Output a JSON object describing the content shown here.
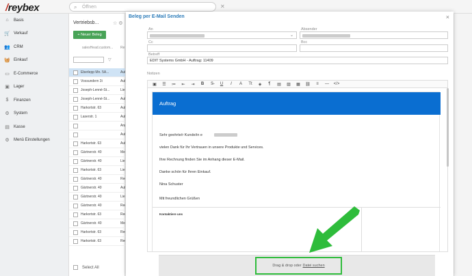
{
  "app": {
    "logo_prefix": "/",
    "logo_text": "reybex"
  },
  "search": {
    "placeholder": "Öffnen"
  },
  "sidebar": {
    "items": [
      {
        "label": "Basis",
        "icon": "home-icon"
      },
      {
        "label": "Verkauf",
        "icon": "cart-icon"
      },
      {
        "label": "CRM",
        "icon": "users-icon"
      },
      {
        "label": "Einkauf",
        "icon": "basket-icon"
      },
      {
        "label": "E-Commerce",
        "icon": "shop-icon"
      },
      {
        "label": "Lager",
        "icon": "box-icon"
      },
      {
        "label": "Finanzen",
        "icon": "money-icon"
      },
      {
        "label": "System",
        "icon": "gear-icon"
      },
      {
        "label": "Kasse",
        "icon": "register-icon"
      },
      {
        "label": "Menü Einstellungen",
        "icon": "settings-icon"
      }
    ]
  },
  "list": {
    "title": "Vertriebsb...",
    "new_button": "+ Neuer Beleg",
    "col1": "salesHead.custom...",
    "col2": "Re",
    "select_all": "Select All",
    "rows": [
      {
        "a": "Eberlepp Mn. 5A...",
        "b": "Auf",
        "selected": true
      },
      {
        "a": "Vossundern 3i",
        "b": "Auf",
        "selected": false
      },
      {
        "a": "Joseph-Lenné-St...",
        "b": "Lie",
        "selected": false
      },
      {
        "a": "Joseph-Lenné-St...",
        "b": "Auf",
        "selected": false
      },
      {
        "a": "Harkortstr. 63",
        "b": "Auf",
        "selected": false
      },
      {
        "a": "Laserstr. 1",
        "b": "Auf",
        "selected": false
      },
      {
        "a": "",
        "b": "Ang",
        "selected": false
      },
      {
        "a": "",
        "b": "Auf",
        "selected": false
      },
      {
        "a": "Harkortstr. 63",
        "b": "Auf",
        "selected": false
      },
      {
        "a": "Gärtnerstr. 40",
        "b": "Me",
        "selected": false
      },
      {
        "a": "Gärtnerstr. 40",
        "b": "Lie",
        "selected": false
      },
      {
        "a": "Harkortstr. 63",
        "b": "Lie",
        "selected": false
      },
      {
        "a": "Gärtnerstr. 40",
        "b": "Rec",
        "selected": false
      },
      {
        "a": "Gärtnerstr. 40",
        "b": "Auf",
        "selected": false
      },
      {
        "a": "Gärtnerstr. 40",
        "b": "Lie",
        "selected": false
      },
      {
        "a": "Gärtnerstr. 40",
        "b": "Rec",
        "selected": false
      },
      {
        "a": "Harkortstr. 63",
        "b": "Rec",
        "selected": false
      },
      {
        "a": "Gärtnerstr. 40",
        "b": "Me",
        "selected": false
      },
      {
        "a": "Harkortstr. 63",
        "b": "Rec",
        "selected": false
      },
      {
        "a": "Harkortstr. 63",
        "b": "Rec",
        "selected": false
      }
    ]
  },
  "modal": {
    "title": "Beleg per E-Mail Senden",
    "close": "×",
    "labels": {
      "to": "An",
      "from": "Absender",
      "cc": "Cc",
      "bcc": "Bcc",
      "subject": "Betreff",
      "notes": "Notizen"
    },
    "subject_value": "EDIT Systems GmbH - Auftrag: 11409",
    "email": {
      "header": "Auftrag",
      "greeting": "Sehr geehrte/r Kunde/in e",
      "line1": "vielen Dank für Ihr Vertrauen in unsere Produkte und Services.",
      "line2": "Ihre Rechnung finden Sie im Anhang dieser E-Mail.",
      "line3": "Danke schön für Ihren Einkauf.",
      "signature": "Nina Schuster",
      "closing": "Mit freundlichen Grüßen",
      "contact": "Kontaktiere uns"
    },
    "dropzone": {
      "text": "Drag & drop oder",
      "link": "Datei suchen"
    }
  },
  "colors": {
    "accent": "#0a6ed1",
    "green": "#48a357",
    "highlight": "#2ebc3b",
    "title_blue": "#2a7ab8"
  }
}
